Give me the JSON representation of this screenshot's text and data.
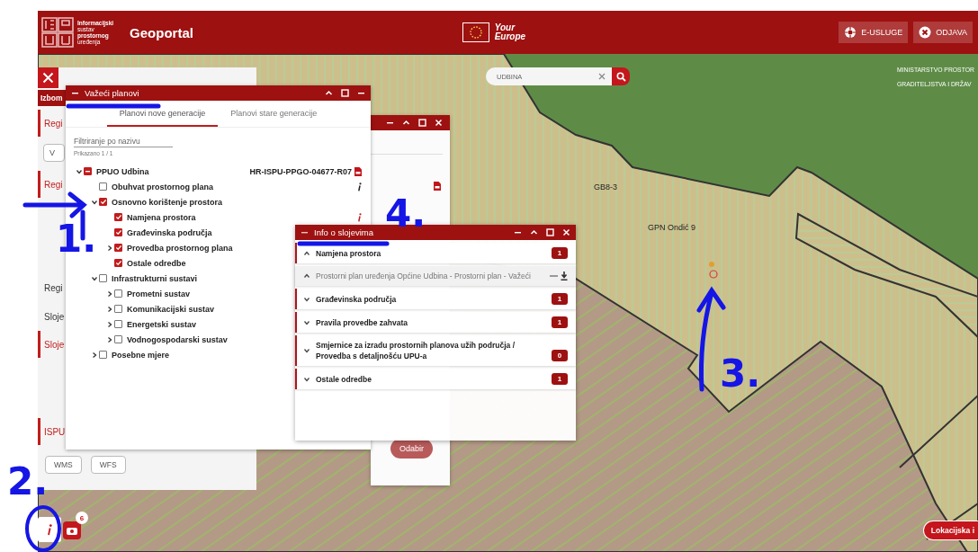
{
  "header": {
    "logo_lines": [
      "Informacijski",
      "sustav",
      "prostornog",
      "uređenja"
    ],
    "title": "Geoportal",
    "eu_text": "Your Europe",
    "buttons": [
      {
        "label": "E-USLUGE",
        "kind": "services"
      },
      {
        "label": "ODJAVA",
        "kind": "logout"
      }
    ]
  },
  "sidebar": {
    "title": "Izbom",
    "items": [
      {
        "kind": "section",
        "label": "Regi",
        "highlighted": true
      },
      {
        "kind": "button",
        "label": "V"
      },
      {
        "kind": "section",
        "label": "Regi",
        "highlighted": true
      },
      {
        "kind": "section",
        "label": "Regi",
        "highlighted": false
      },
      {
        "kind": "section",
        "label": "Sloje",
        "highlighted": false
      },
      {
        "kind": "section",
        "label": "Sloje",
        "highlighted": true
      },
      {
        "kind": "section",
        "label": "ISPU",
        "highlighted": true
      }
    ],
    "buttons": [
      "WMS",
      "WFS"
    ]
  },
  "plans_window": {
    "title": "Važeći planovi",
    "tabs": [
      {
        "label": "Planovi nove generacije",
        "selected": true
      },
      {
        "label": "Planovi stare generacije",
        "selected": false
      }
    ],
    "filter": {
      "placeholder": "Filtriranje po nazivu"
    },
    "count": "Prikazano 1 / 1",
    "tree": [
      {
        "label": "PPUO Udbina",
        "checked": true,
        "indeterminate": true,
        "expanded": true,
        "doc": "HR-ISPU-PPGO-04677-R07",
        "children": [
          {
            "label": "Obuhvat prostornog plana",
            "checked": false,
            "indeterminate": false,
            "info_alert": false
          },
          {
            "label": "Osnovno korištenje prostora",
            "checked": true,
            "indeterminate": false,
            "expanded": true,
            "children": [
              {
                "label": "Namjena prostora",
                "checked": true,
                "indeterminate": false,
                "info_alert": true
              },
              {
                "label": "Građevinska područja",
                "checked": true,
                "indeterminate": false
              },
              {
                "label": "Provedba prostornog plana",
                "checked": true,
                "indeterminate": false,
                "expanded": false
              },
              {
                "label": "Ostale odredbe",
                "checked": true,
                "indeterminate": false
              }
            ]
          },
          {
            "label": "Infrastrukturni sustavi",
            "checked": false,
            "indeterminate": false,
            "expanded": true,
            "children": [
              {
                "label": "Prometni sustav",
                "checked": false,
                "indeterminate": false,
                "expanded": false
              },
              {
                "label": "Komunikacijski sustav",
                "checked": false,
                "indeterminate": false,
                "expanded": false
              },
              {
                "label": "Energetski sustav",
                "checked": false,
                "indeterminate": false,
                "expanded": false
              },
              {
                "label": "Vodnogospodarski sustav",
                "checked": false,
                "indeterminate": false,
                "expanded": false
              }
            ]
          },
          {
            "label": "Posebne mjere",
            "checked": false,
            "indeterminate": false,
            "expanded": false
          }
        ]
      }
    ]
  },
  "mid_window": {
    "button": "Odabir"
  },
  "info_window": {
    "title": "Info o slojevima",
    "rows": [
      {
        "kind": "group",
        "label": "Namjena prostora",
        "expanded": true,
        "count": "1"
      },
      {
        "kind": "item",
        "label": "Prostorni plan uređenja Općine Udbina - Prostorni plan - Važeći",
        "expanded": true
      },
      {
        "kind": "group",
        "label": "Građevinska područja",
        "expanded": false,
        "count": "1"
      },
      {
        "kind": "group",
        "label": "Pravila provedbe zahvata",
        "expanded": false,
        "count": "1"
      },
      {
        "kind": "group",
        "label": "Smjernice za izradu prostornih planova užih područja / Provedba s detaljnošću UPU-a",
        "expanded": false,
        "count": "0"
      },
      {
        "kind": "group",
        "label": "Ostale odredbe",
        "expanded": false,
        "count": "1"
      }
    ]
  },
  "map": {
    "search": {
      "value": "UDBINA"
    },
    "ministry_lines": [
      "MINISTARSTVO PROSTOR",
      "GRADITELJSTVA I DRŽAV"
    ],
    "labels": [
      "GB8-3",
      "GPN Ondić 9"
    ],
    "location_button": "Lokacijska i",
    "camera_badge": "6"
  },
  "annotations": [
    {
      "label": "1."
    },
    {
      "label": "2."
    },
    {
      "label": "3."
    },
    {
      "label": "4."
    }
  ]
}
